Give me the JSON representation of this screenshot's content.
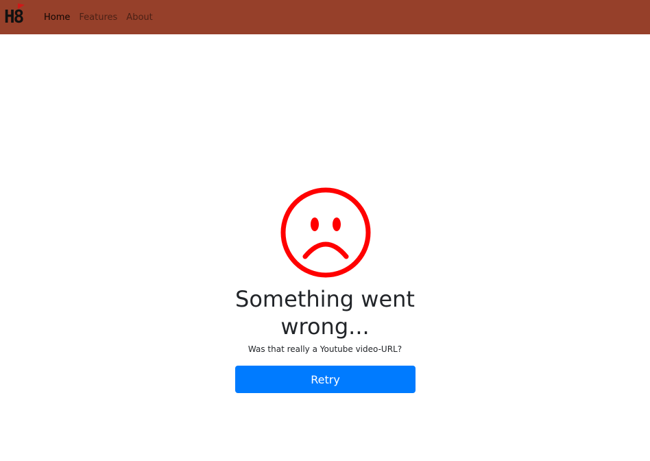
{
  "navbar": {
    "brand": "H8",
    "links": [
      {
        "label": "Home",
        "active": true
      },
      {
        "label": "Features",
        "active": false
      },
      {
        "label": "About",
        "active": false
      }
    ],
    "background": "#96402a"
  },
  "error": {
    "icon": "sad-face-icon",
    "icon_color": "#ff0000",
    "title": "Something went wrong...",
    "message": "Was that really a Youtube video-URL?",
    "retry_label": "Retry",
    "button_color": "#007bff"
  }
}
